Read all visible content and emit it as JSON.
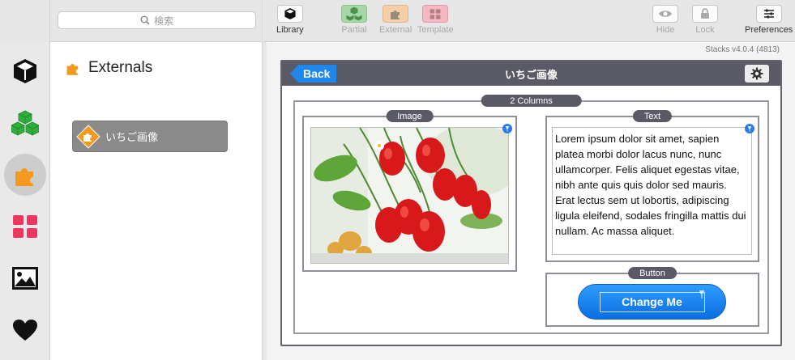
{
  "search": {
    "placeholder": "検索"
  },
  "sidebar": {
    "title": "Externals",
    "items": [
      {
        "label": "いちご画像"
      }
    ]
  },
  "toolbar": {
    "library": "Library",
    "partial": "Partial",
    "external": "External",
    "template": "Template",
    "hide": "Hide",
    "lock": "Lock",
    "preferences": "Preferences"
  },
  "version": "Stacks v4.0.4 (4813)",
  "panel": {
    "back_label": "Back",
    "title": "いちご画像"
  },
  "columns": {
    "label": "2 Columns"
  },
  "image_box": {
    "label": "Image"
  },
  "text_box": {
    "label": "Text",
    "body": "Lorem ipsum dolor sit amet, sapien platea morbi dolor lacus nunc, nunc ullamcorper. Felis aliquet egestas vitae, nibh ante quis quis dolor sed mauris. Erat lectus sem ut lobortis, adipiscing ligula eleifend, sodales fringilla mattis dui nullam. Ac massa aliquet."
  },
  "button_box": {
    "label": "Button",
    "button_text": "Change Me"
  },
  "colors": {
    "accent_blue": "#1f86ea",
    "panel_header": "#5a5a66",
    "external_orange": "#f39a1e",
    "partial_green": "#3bb34a",
    "template_pink": "#f0365f"
  }
}
